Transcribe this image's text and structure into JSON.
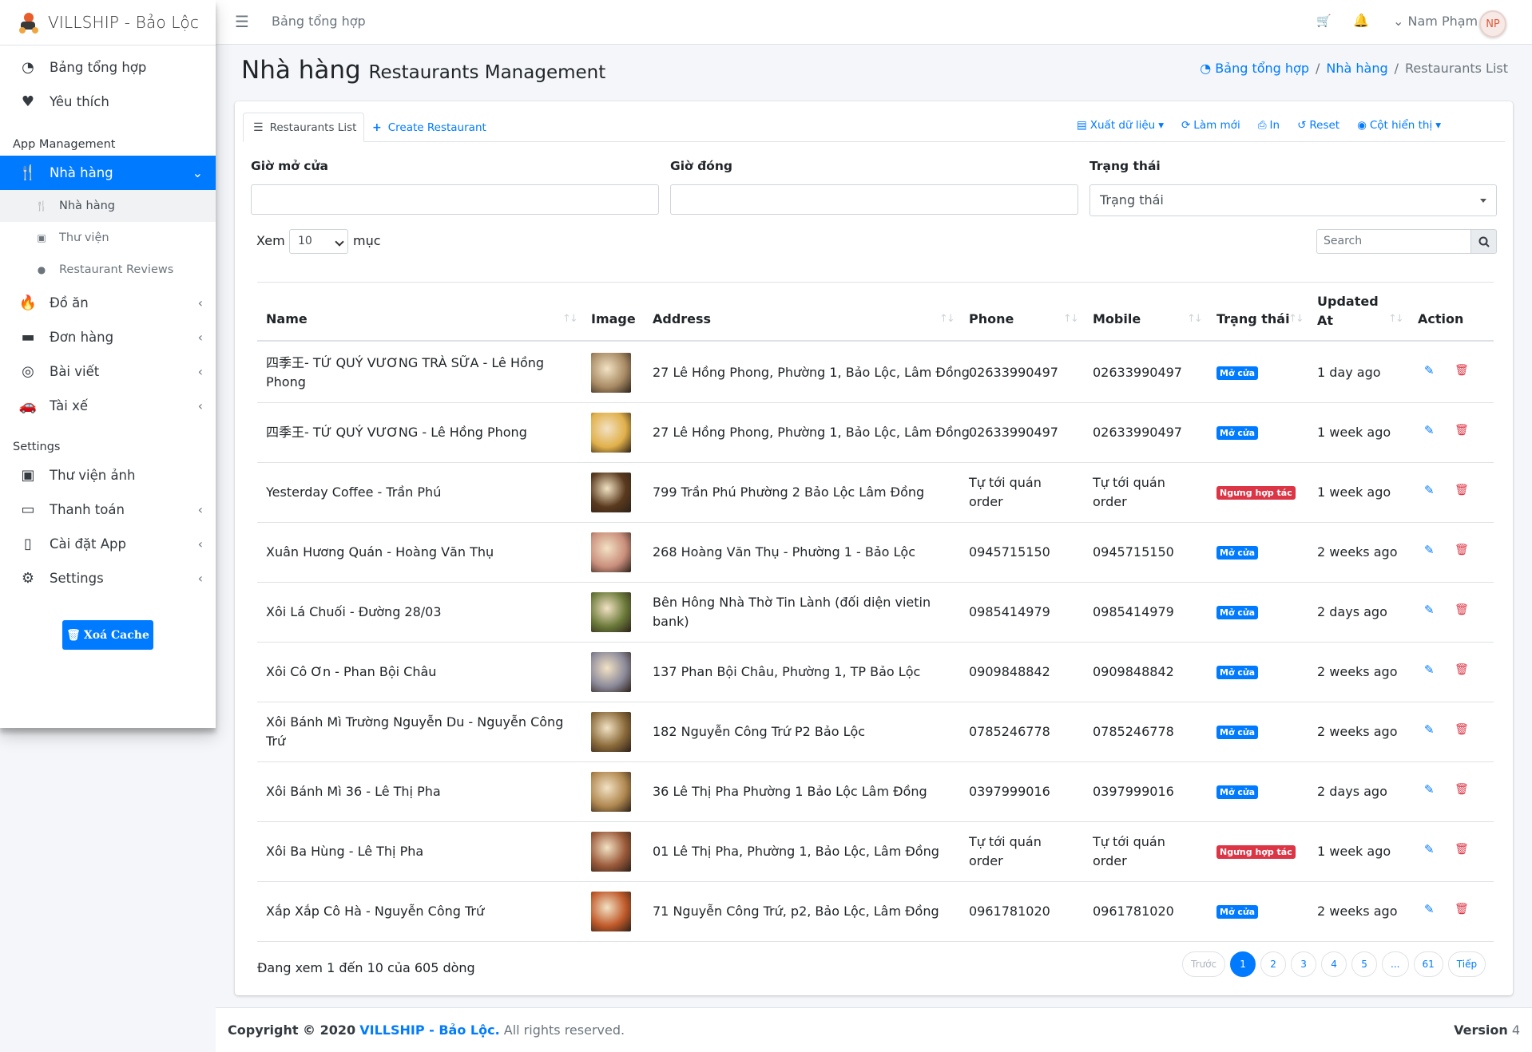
{
  "brand": "VILLSHIP - Bảo Lộc",
  "sidebar": {
    "top_items": [
      {
        "label": "Bảng tổng hợp",
        "icon": "dashboard-icon"
      },
      {
        "label": "Yêu thích",
        "icon": "heart-icon"
      }
    ],
    "app_header": "App Management",
    "restaurant": "Nhà hàng",
    "sub_items": [
      {
        "label": "Nhà hàng",
        "icon": "utensils-icon"
      },
      {
        "label": "Thư viện",
        "icon": "image-icon"
      },
      {
        "label": "Restaurant Reviews",
        "icon": "comments-icon"
      }
    ],
    "app_items": [
      {
        "label": "Đồ ăn",
        "icon": "fire-icon"
      },
      {
        "label": "Đơn hàng",
        "icon": "archive-icon"
      },
      {
        "label": "Bài viết",
        "icon": "life-ring-icon"
      },
      {
        "label": "Tài xế",
        "icon": "car-icon"
      }
    ],
    "settings_header": "Settings",
    "settings_items": [
      {
        "label": "Thư viện ảnh",
        "icon": "image-icon"
      },
      {
        "label": "Thanh toán",
        "icon": "credit-card-icon"
      },
      {
        "label": "Cài đặt App",
        "icon": "mobile-icon"
      },
      {
        "label": "Settings",
        "icon": "cogs-icon"
      }
    ],
    "cache_button": "Xoá Cache"
  },
  "topbar": {
    "crumb": "Bảng tổng hợp",
    "user": "Nam Phạm",
    "avatar": "NP"
  },
  "header": {
    "title": "Nhà hàng",
    "subtitle": "Restaurants Management",
    "breadcrumb": [
      "Bảng tổng hợp",
      "Nhà hàng",
      "Restaurants List"
    ]
  },
  "tabs": {
    "list": "Restaurants List",
    "create": "Create Restaurant"
  },
  "toolbar": {
    "export": "Xuất dữ liệu",
    "refresh": "Làm mới",
    "print": "In",
    "reset": "Reset",
    "columns": "Cột hiển thị"
  },
  "filters": {
    "open_label": "Giờ mở cửa",
    "close_label": "Giờ đóng",
    "status_label": "Trạng thái",
    "status_value": "Trạng thái"
  },
  "table_controls": {
    "show": "Xem",
    "length": "10",
    "entries": "mục",
    "search_placeholder": "Search"
  },
  "columns": {
    "name": "Name",
    "image": "Image",
    "address": "Address",
    "phone": "Phone",
    "mobile": "Mobile",
    "status": "Trạng thái",
    "updated_1": "Updated",
    "updated_2": "At",
    "action": "Action"
  },
  "rows": [
    {
      "name_1": "四季王- TỨ QUÝ VƯƠNG TRÀ SỮA - Lê Hồng",
      "name_2": "Phong",
      "address_1": "27 Lê Hồng Phong, Phường 1, Bảo Lộc, Lâm Đồng",
      "address_2": "",
      "phone_1": "02633990497",
      "phone_2": "",
      "mobile_1": "02633990497",
      "mobile_2": "",
      "status": "Mở cửa",
      "status_type": "ok",
      "updated": "1 day ago",
      "thumb": "#a88a64"
    },
    {
      "name_1": "四季王- TỨ QUÝ VƯƠNG - Lê Hồng Phong",
      "name_2": "",
      "address_1": "27 Lê Hồng Phong, Phường 1, Bảo Lộc, Lâm Đồng",
      "address_2": "",
      "phone_1": "02633990497",
      "phone_2": "",
      "mobile_1": "02633990497",
      "mobile_2": "",
      "status": "Mở cửa",
      "status_type": "ok",
      "updated": "1 week ago",
      "thumb": "#e0b04a"
    },
    {
      "name_1": "Yesterday Coffee - Trần Phú",
      "name_2": "",
      "address_1": "799 Trần Phú Phường 2 Bảo Lộc Lâm Đồng",
      "address_2": "",
      "phone_1": "Tự tới quán",
      "phone_2": "order",
      "mobile_1": "Tự tới quán",
      "mobile_2": "order",
      "status": "Ngưng hợp tác",
      "status_type": "stop",
      "updated": "1 week ago",
      "thumb": "#5a3a1e"
    },
    {
      "name_1": "Xuân Hương Quán - Hoàng Văn Thụ",
      "name_2": "",
      "address_1": "268 Hoàng Văn Thụ - Phường 1 - Bảo Lộc",
      "address_2": "",
      "phone_1": "0945715150",
      "phone_2": "",
      "mobile_1": "0945715150",
      "mobile_2": "",
      "status": "Mở cửa",
      "status_type": "ok",
      "updated": "2 weeks ago",
      "thumb": "#c98e7c"
    },
    {
      "name_1": "Xôi Lá Chuối - Đường 28/03",
      "name_2": "",
      "address_1": "Bên Hông Nhà Thờ Tin Lành (đối diện vietin",
      "address_2": "bank)",
      "phone_1": "0985414979",
      "phone_2": "",
      "mobile_1": "0985414979",
      "mobile_2": "",
      "status": "Mở cửa",
      "status_type": "ok",
      "updated": "2 days ago",
      "thumb": "#6b7a3a"
    },
    {
      "name_1": "Xôi Cô Ơn - Phan Bội Châu",
      "name_2": "",
      "address_1": "137 Phan Bội Châu, Phường 1, TP Bảo Lộc",
      "address_2": "",
      "phone_1": "0909848842",
      "phone_2": "",
      "mobile_1": "0909848842",
      "mobile_2": "",
      "status": "Mở cửa",
      "status_type": "ok",
      "updated": "2 weeks ago",
      "thumb": "#8c8a9a"
    },
    {
      "name_1": "Xôi Bánh Mì Trường Nguyễn Du - Nguyễn Công",
      "name_2": "Trứ",
      "address_1": "182 Nguyễn Công Trứ P2 Bảo Lộc",
      "address_2": "",
      "phone_1": "0785246778",
      "phone_2": "",
      "mobile_1": "0785246778",
      "mobile_2": "",
      "status": "Mở cửa",
      "status_type": "ok",
      "updated": "2 weeks ago",
      "thumb": "#8a6a3a"
    },
    {
      "name_1": "Xôi Bánh Mì 36 - Lê Thị Pha",
      "name_2": "",
      "address_1": "36 Lê Thị Pha Phường 1 Bảo Lộc Lâm Đồng",
      "address_2": "",
      "phone_1": "0397999016",
      "phone_2": "",
      "mobile_1": "0397999016",
      "mobile_2": "",
      "status": "Mở cửa",
      "status_type": "ok",
      "updated": "2 days ago",
      "thumb": "#b08850"
    },
    {
      "name_1": "Xôi Ba Hùng - Lê Thị Pha",
      "name_2": "",
      "address_1": "01 Lê Thị Pha, Phường 1, Bảo Lộc, Lâm Đồng",
      "address_2": "",
      "phone_1": "Tự tới quán",
      "phone_2": "order",
      "mobile_1": "Tự tới quán",
      "mobile_2": "order",
      "status": "Ngưng hợp tác",
      "status_type": "stop",
      "updated": "1 week ago",
      "thumb": "#9a5a3a"
    },
    {
      "name_1": "Xắp Xắp Cô Hà - Nguyễn Công Trứ",
      "name_2": "",
      "address_1": "71 Nguyễn Công Trứ, p2, Bảo Lộc, Lâm Đồng",
      "address_2": "",
      "phone_1": "0961781020",
      "phone_2": "",
      "mobile_1": "0961781020",
      "mobile_2": "",
      "status": "Mở cửa",
      "status_type": "ok",
      "updated": "2 weeks ago",
      "thumb": "#c05a2a"
    }
  ],
  "table_info": "Đang xem 1 đến 10 của 605 dòng",
  "pagination": [
    "Trước",
    "1",
    "2",
    "3",
    "4",
    "5",
    "...",
    "61",
    "Tiếp"
  ],
  "footer": {
    "copyright_prefix": "Copyright © 2020",
    "brand": "VILLSHIP - Bảo Lộc.",
    "suffix": "All rights reserved.",
    "version_label": "Version",
    "version": "4"
  }
}
